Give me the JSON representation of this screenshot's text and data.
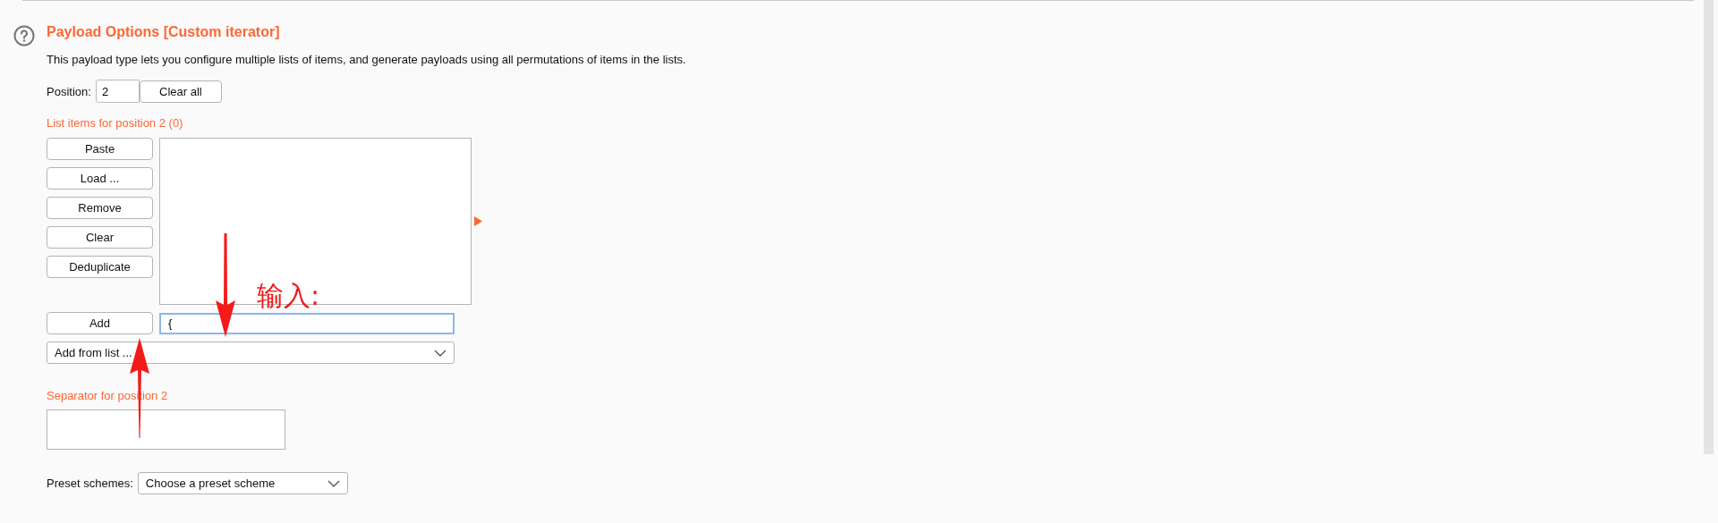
{
  "title": "Payload Options [Custom iterator]",
  "description": "This payload type lets you configure multiple lists of items, and generate payloads using all permutations of items in the lists.",
  "position": {
    "label": "Position:",
    "value": "2",
    "button": "Clear all"
  },
  "list_label": "List items for position 2 (0)",
  "list_buttons": [
    "Paste",
    "Load ...",
    "Remove",
    "Clear",
    "Deduplicate"
  ],
  "add": {
    "button": "Add",
    "value": "{",
    "focused": true
  },
  "add_from_list": {
    "value": "Add from list ..."
  },
  "separator": {
    "label": "Separator for position 2"
  },
  "preset": {
    "label": "Preset schemes:",
    "value": "Choose a preset scheme"
  },
  "annotation": {
    "text": "输入:"
  }
}
